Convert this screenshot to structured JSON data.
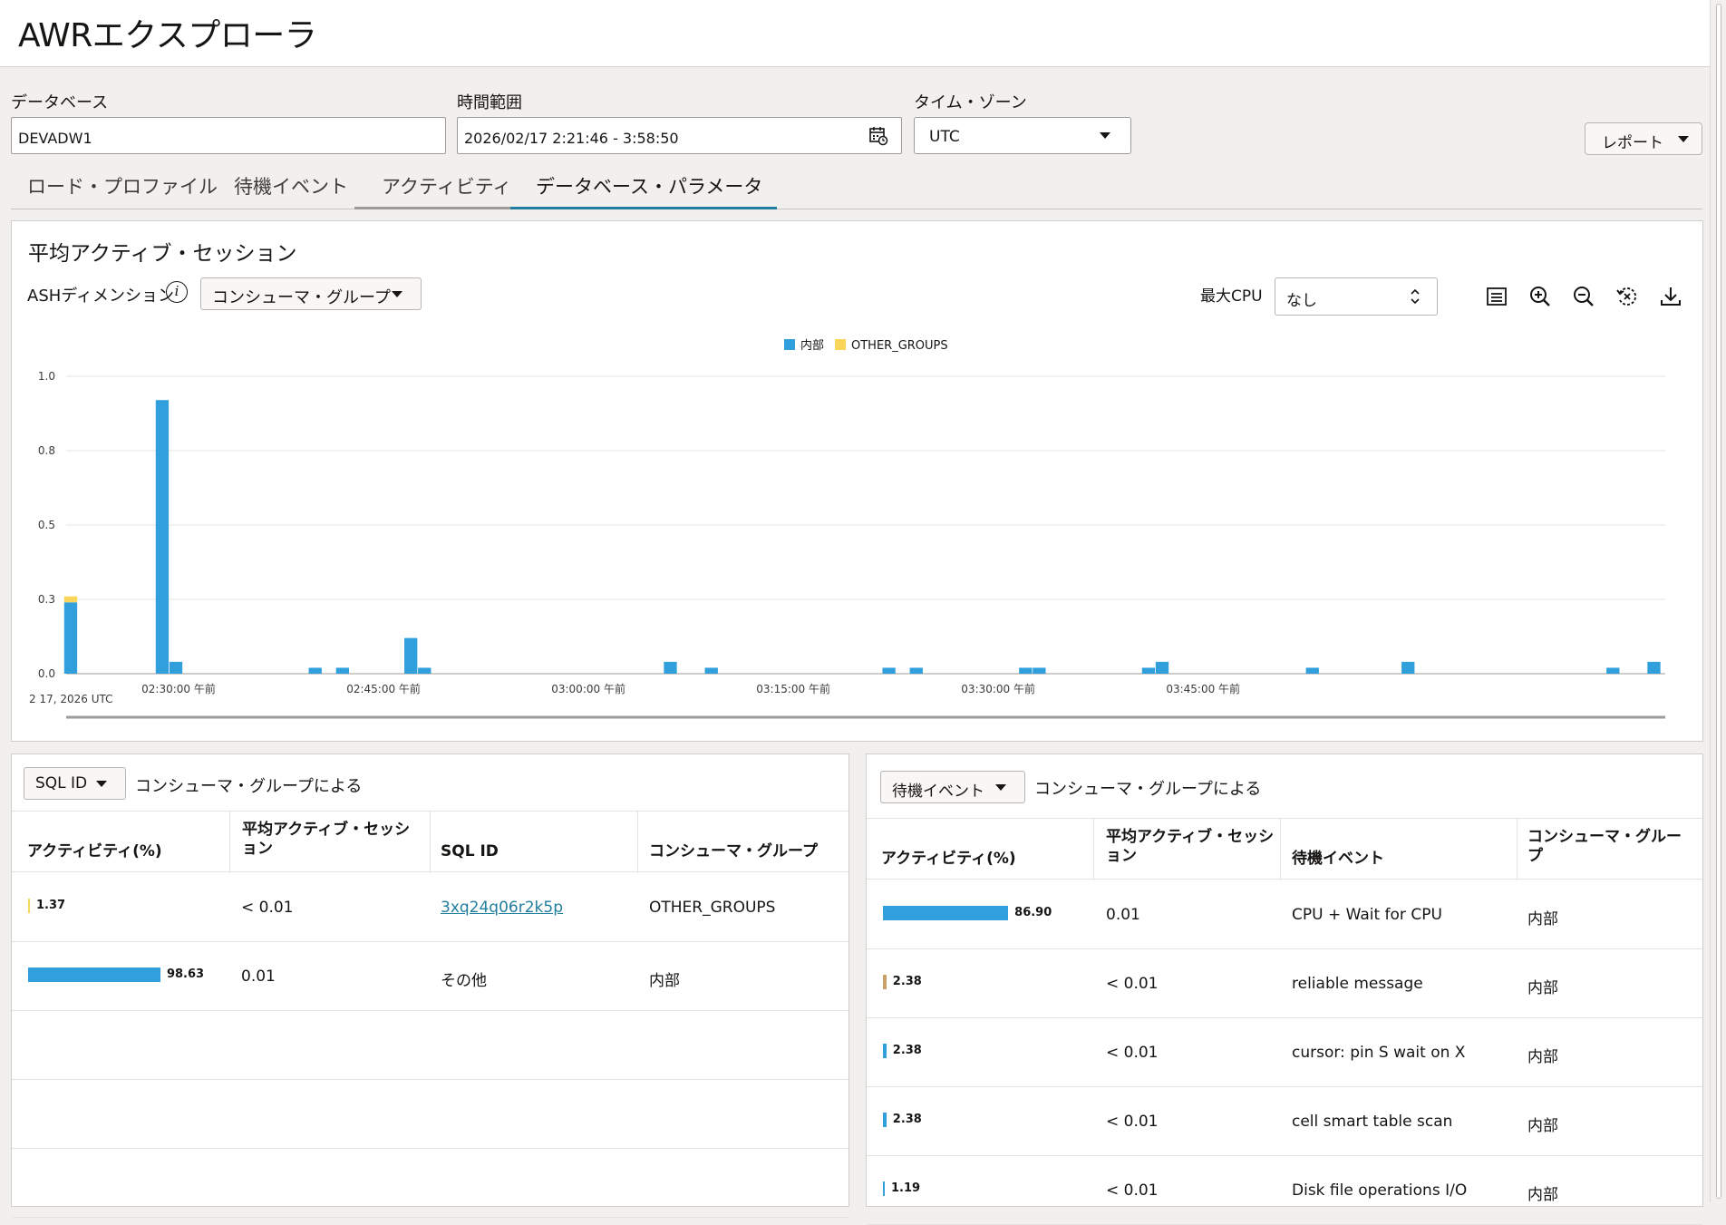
{
  "app": {
    "title": "AWRエクスプローラ"
  },
  "filters": {
    "database_label": "データベース",
    "database_value": "DEVADW1",
    "time_range_label": "時間範囲",
    "time_range_value": "2026/02/17 2:21:46 - 3:58:50",
    "timezone_label": "タイム・ゾーン",
    "timezone_value": "UTC",
    "report_label": "レポート"
  },
  "tabs": [
    {
      "label": "ロード・プロファイル"
    },
    {
      "label": "待機イベント"
    },
    {
      "label": "アクティビティ"
    },
    {
      "label": "データベース・パラメータ"
    }
  ],
  "ash_panel": {
    "title": "平均アクティブ・セッション",
    "dimension_label": "ASHディメンション",
    "dimension_value": "コンシューマ・グループ",
    "max_cpu_label": "最大CPU",
    "max_cpu_value": "なし",
    "tools": [
      "legend-icon",
      "zoom-in-icon",
      "zoom-out-icon",
      "reset-zoom-icon",
      "download-icon"
    ]
  },
  "chart_data": {
    "type": "bar",
    "stacked": true,
    "legend": [
      {
        "name": "内部",
        "color": "#309fdb"
      },
      {
        "name": "OTHER_GROUPS",
        "color": "#fad55c"
      }
    ],
    "y_ticks": [
      "0.0",
      "0.3",
      "0.5",
      "0.8",
      "1.0"
    ],
    "ylim": [
      0,
      1.0
    ],
    "x_ticks": [
      "02:30:00 午前",
      "02:45:00 午前",
      "03:00:00 午前",
      "03:15:00 午前",
      "03:30:00 午前",
      "03:45:00 午前"
    ],
    "x_start_label": "2 17, 2026 UTC",
    "xlim_minutes": [
      21.77,
      138.83
    ],
    "x_tick_minutes": [
      30,
      45,
      60,
      75,
      90,
      105
    ],
    "bar_width_minutes": 0.95,
    "series": [
      {
        "name": "内部",
        "points": [
          [
            22.1,
            0.24
          ],
          [
            28.8,
            0.92
          ],
          [
            29.8,
            0.04
          ],
          [
            40.0,
            0.02
          ],
          [
            42.0,
            0.02
          ],
          [
            47.0,
            0.12
          ],
          [
            48.0,
            0.02
          ],
          [
            66.0,
            0.04
          ],
          [
            69.0,
            0.02
          ],
          [
            82.0,
            0.02
          ],
          [
            84.0,
            0.02
          ],
          [
            92.0,
            0.02
          ],
          [
            93.0,
            0.02
          ],
          [
            101.0,
            0.02
          ],
          [
            102.0,
            0.04
          ],
          [
            113.0,
            0.02
          ],
          [
            120.0,
            0.04
          ],
          [
            135.0,
            0.02
          ],
          [
            138.0,
            0.04
          ]
        ]
      },
      {
        "name": "OTHER_GROUPS",
        "points": [
          [
            22.1,
            0.02
          ]
        ]
      }
    ]
  },
  "sql_panel": {
    "dimension_value": "SQL ID",
    "by_label": "コンシューマ・グループによる",
    "columns": [
      "アクティビティ(%)",
      "平均アクティブ・セッション",
      "SQL ID",
      "コンシューマ・グループ"
    ],
    "rows": [
      {
        "activity": "1.37",
        "avg": "< 0.01",
        "sql_id": "3xq24q06r2k5p",
        "group": "OTHER_GROUPS",
        "bar_pct": 1.37,
        "bar_color": "#fad55c"
      },
      {
        "activity": "98.63",
        "avg": "0.01",
        "sql_id": "その他",
        "group": "内部",
        "bar_pct": 98.63,
        "bar_color": "#309fdb"
      }
    ]
  },
  "wait_panel": {
    "dimension_value": "待機イベント",
    "by_label": "コンシューマ・グループによる",
    "columns": [
      "アクティビティ(%)",
      "平均アクティブ・セッション",
      "待機イベント",
      "コンシューマ・グループ"
    ],
    "rows": [
      {
        "activity": "86.90",
        "avg": "0.01",
        "event": "CPU + Wait for CPU",
        "group": "内部",
        "bar_pct": 86.9,
        "bar_color": "#309fdb"
      },
      {
        "activity": "2.38",
        "avg": "< 0.01",
        "event": "reliable message",
        "group": "内部",
        "bar_pct": 2.38,
        "bar_color": "#c8a26a"
      },
      {
        "activity": "2.38",
        "avg": "< 0.01",
        "event": "cursor: pin S wait on X",
        "group": "内部",
        "bar_pct": 2.38,
        "bar_color": "#309fdb"
      },
      {
        "activity": "2.38",
        "avg": "< 0.01",
        "event": "cell smart table scan",
        "group": "内部",
        "bar_pct": 2.38,
        "bar_color": "#309fdb"
      },
      {
        "activity": "1.19",
        "avg": "< 0.01",
        "event": "Disk file operations I/O",
        "group": "内部",
        "bar_pct": 1.19,
        "bar_color": "#309fdb"
      }
    ]
  }
}
